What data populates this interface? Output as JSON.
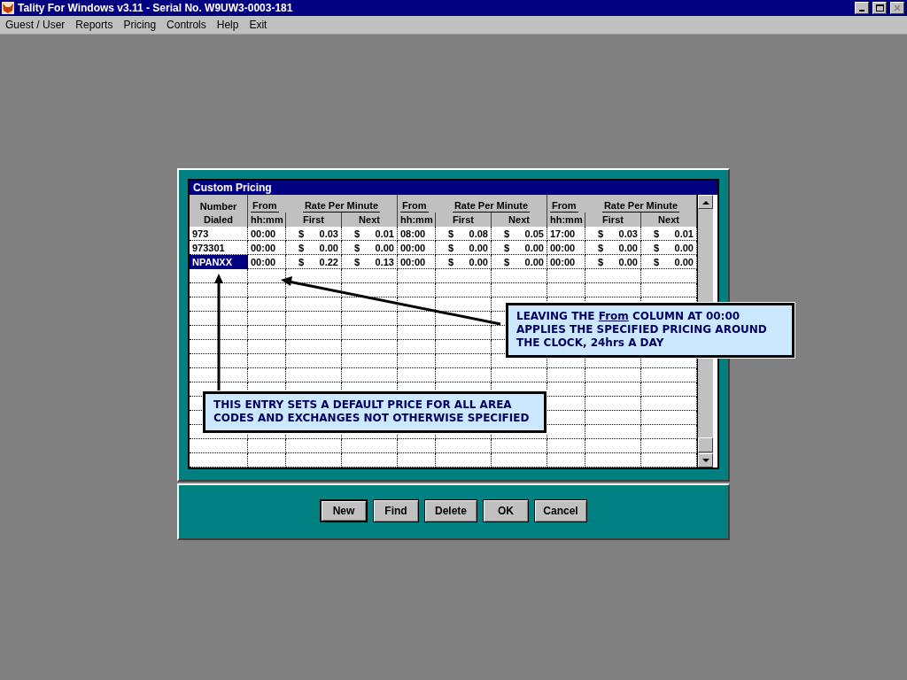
{
  "window": {
    "title": "Tality For Windows v3.11 - Serial No. W9UW3-0003-181"
  },
  "menu": [
    "Guest / User",
    "Reports",
    "Pricing",
    "Controls",
    "Help",
    "Exit"
  ],
  "dialog": {
    "title": "Custom Pricing",
    "number_header": [
      "Number",
      "Dialed"
    ],
    "periods": [
      {
        "from": "From",
        "unit": "hh:mm",
        "rate": "Rate Per Minute",
        "first": "First",
        "next": "Next"
      },
      {
        "from": "From",
        "unit": "hh:mm",
        "rate": "Rate Per Minute",
        "first": "First",
        "next": "Next"
      },
      {
        "from": "From",
        "unit": "hh:mm",
        "rate": "Rate Per Minute",
        "first": "First",
        "next": "Next"
      }
    ],
    "rows": [
      {
        "number": "973",
        "selected": false,
        "periods": [
          {
            "from": "00:00",
            "first": [
              "$",
              "0.03"
            ],
            "next": [
              "$",
              "0.01"
            ]
          },
          {
            "from": "08:00",
            "first": [
              "$",
              "0.08"
            ],
            "next": [
              "$",
              "0.05"
            ]
          },
          {
            "from": "17:00",
            "first": [
              "$",
              "0.03"
            ],
            "next": [
              "$",
              "0.01"
            ]
          }
        ]
      },
      {
        "number": "973301",
        "selected": false,
        "periods": [
          {
            "from": "00:00",
            "first": [
              "$",
              "0.00"
            ],
            "next": [
              "$",
              "0.00"
            ]
          },
          {
            "from": "00:00",
            "first": [
              "$",
              "0.00"
            ],
            "next": [
              "$",
              "0.00"
            ]
          },
          {
            "from": "00:00",
            "first": [
              "$",
              "0.00"
            ],
            "next": [
              "$",
              "0.00"
            ]
          }
        ]
      },
      {
        "number": "NPANXX",
        "selected": true,
        "periods": [
          {
            "from": "00:00",
            "first": [
              "$",
              "0.22"
            ],
            "next": [
              "$",
              "0.13"
            ]
          },
          {
            "from": "00:00",
            "first": [
              "$",
              "0.00"
            ],
            "next": [
              "$",
              "0.00"
            ]
          },
          {
            "from": "00:00",
            "first": [
              "$",
              "0.00"
            ],
            "next": [
              "$",
              "0.00"
            ]
          }
        ]
      }
    ],
    "buttons": [
      {
        "label": "New",
        "default": true
      },
      {
        "label": "Find",
        "default": false
      },
      {
        "label": "Delete",
        "default": false
      },
      {
        "label": "OK",
        "default": false
      },
      {
        "label": "Cancel",
        "default": false
      }
    ]
  },
  "callouts": [
    {
      "before": "LEAVING THE ",
      "underlined": "From",
      "after": " COLUMN AT 00:00 APPLIES THE SPECIFIED PRICING AROUND THE CLOCK, 24hrs A DAY"
    },
    {
      "before": "THIS ENTRY SETS A DEFAULT PRICE FOR ALL AREA CODES AND EXCHANGES NOT OTHERWISE SPECIFIED"
    }
  ]
}
